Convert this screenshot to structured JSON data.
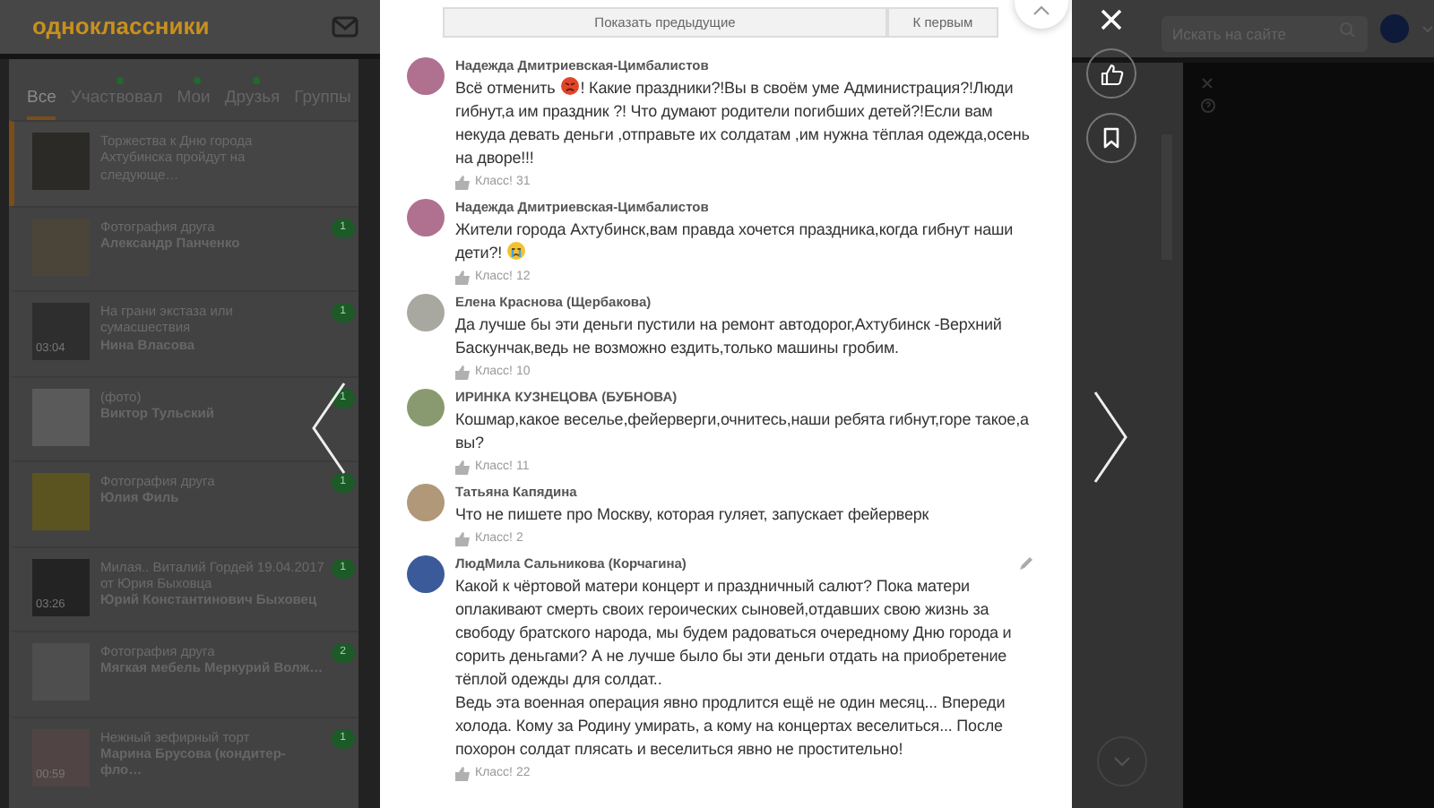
{
  "header": {
    "logo": "одноклассники"
  },
  "tabs": [
    {
      "label": "Все",
      "selected": true,
      "dot": false
    },
    {
      "label": "Участвовал",
      "selected": false,
      "dot": true
    },
    {
      "label": "Мои",
      "selected": false,
      "dot": true
    },
    {
      "label": "Друзья",
      "selected": false,
      "dot": true
    },
    {
      "label": "Группы",
      "selected": false,
      "dot": false
    }
  ],
  "feed": [
    {
      "title": "Торжества к Дню города Ахтубинска пройдут на следующе…",
      "selected": true
    },
    {
      "title": "Фотография друга",
      "author": "Александр Панченко",
      "count": "1",
      "selected": false
    },
    {
      "title": "На грани экстаза или сумасшествия",
      "author": "Нина Власова",
      "count": "1",
      "duration": "03:04",
      "selected": false
    },
    {
      "title": "(фото)",
      "author": "Виктор Тульский",
      "count": "1",
      "selected": false
    },
    {
      "title": "Фотография друга",
      "author": "Юлия Филь",
      "count": "1",
      "selected": false
    },
    {
      "title": "Милая.. Виталий Гордей 19.04.2017 от Юрия Быховца",
      "author": "Юрий Константинович Быховец",
      "count": "1",
      "duration": "03:26",
      "selected": false
    },
    {
      "title": "Фотография друга",
      "author": "Мягкая мебель Меркурий Волж…",
      "count": "2",
      "selected": false
    },
    {
      "title": "Нежный зефирный торт",
      "author": "Марина Брусова (кондитер-фло…",
      "count": "1",
      "duration": "00:59",
      "selected": false
    }
  ],
  "pager": {
    "previous": "Показать предыдущие",
    "first": "К первым"
  },
  "comments": [
    {
      "author": "Надежда Дмитриевская-Цимбалистов",
      "editable": false,
      "likes": "Класс! 31",
      "segments": [
        {
          "kind": "inline",
          "text": "Всё отменить"
        },
        {
          "kind": "emoji-angry"
        },
        {
          "kind": "inline",
          "text": "! Какие праздники?!Вы в своём уме Администрация?!Люди"
        },
        {
          "kind": "block",
          "text": "гибнут,а им праздник ?! Что думают родители погибших детей?!Если вам некуда девать деньги ,отправьте их солдатам ,им нужна тёплая одежда,осень на дворе!!!"
        }
      ]
    },
    {
      "author": "Надежда Дмитриевская-Цимбалистов",
      "editable": false,
      "likes": "Класс! 12",
      "segments": [
        {
          "kind": "block",
          "text": "Жители города Ахтубинск,вам правда хочется праздника,когда гибнут наши"
        },
        {
          "kind": "inline",
          "text": "дети?!"
        },
        {
          "kind": "emoji-crying"
        }
      ]
    },
    {
      "author": "Елена Краснова (Щербакова)",
      "editable": false,
      "likes": "Класс! 10",
      "segments": [
        {
          "kind": "block",
          "text": "Да лучше бы эти деньги пустили на ремонт автодорог,Ахтубинск -Верхний Баскунчак,ведь не возможно ездить,только машины гробим."
        }
      ]
    },
    {
      "author": "ИРИНКА КУЗНЕЦОВА (БУБНОВА)",
      "editable": false,
      "likes": "Класс! 11",
      "segments": [
        {
          "kind": "block",
          "text": "Кошмар,какое веселье,фейерверги,очнитесь,наши ребята гибнут,горе такое,а вы?"
        }
      ]
    },
    {
      "author": "Татьяна Капядина",
      "editable": false,
      "likes": "Класс! 2",
      "segments": [
        {
          "kind": "block",
          "text": "Что не пишете про Москву, которая гуляет, запускает фейерверк"
        }
      ]
    },
    {
      "author": "ЛюдМила Сальникова (Корчагина)",
      "editable": true,
      "likes": "Класс! 22",
      "segments": [
        {
          "kind": "block",
          "text": "Какой к чёртовой матери концерт и праздничный салют? Пока матери оплакивают смерть своих героических сыновей,отдавших свою жизнь за свободу братского народа, мы будем радоваться очередному Дню города и сорить деньгами? А не лучше было бы эти деньги отдать на приобретение тёплой одежды для солдат.."
        },
        {
          "kind": "block",
          "text": "Ведь эта военная операция явно продлится ещё не один месяц... Впереди холода. Кому за Родину умирать, а кому на концертах веселиться... После похорон солдат плясать и веселиться явно не простительно!"
        }
      ]
    }
  ],
  "search": {
    "placeholder": "Искать на сайте"
  }
}
